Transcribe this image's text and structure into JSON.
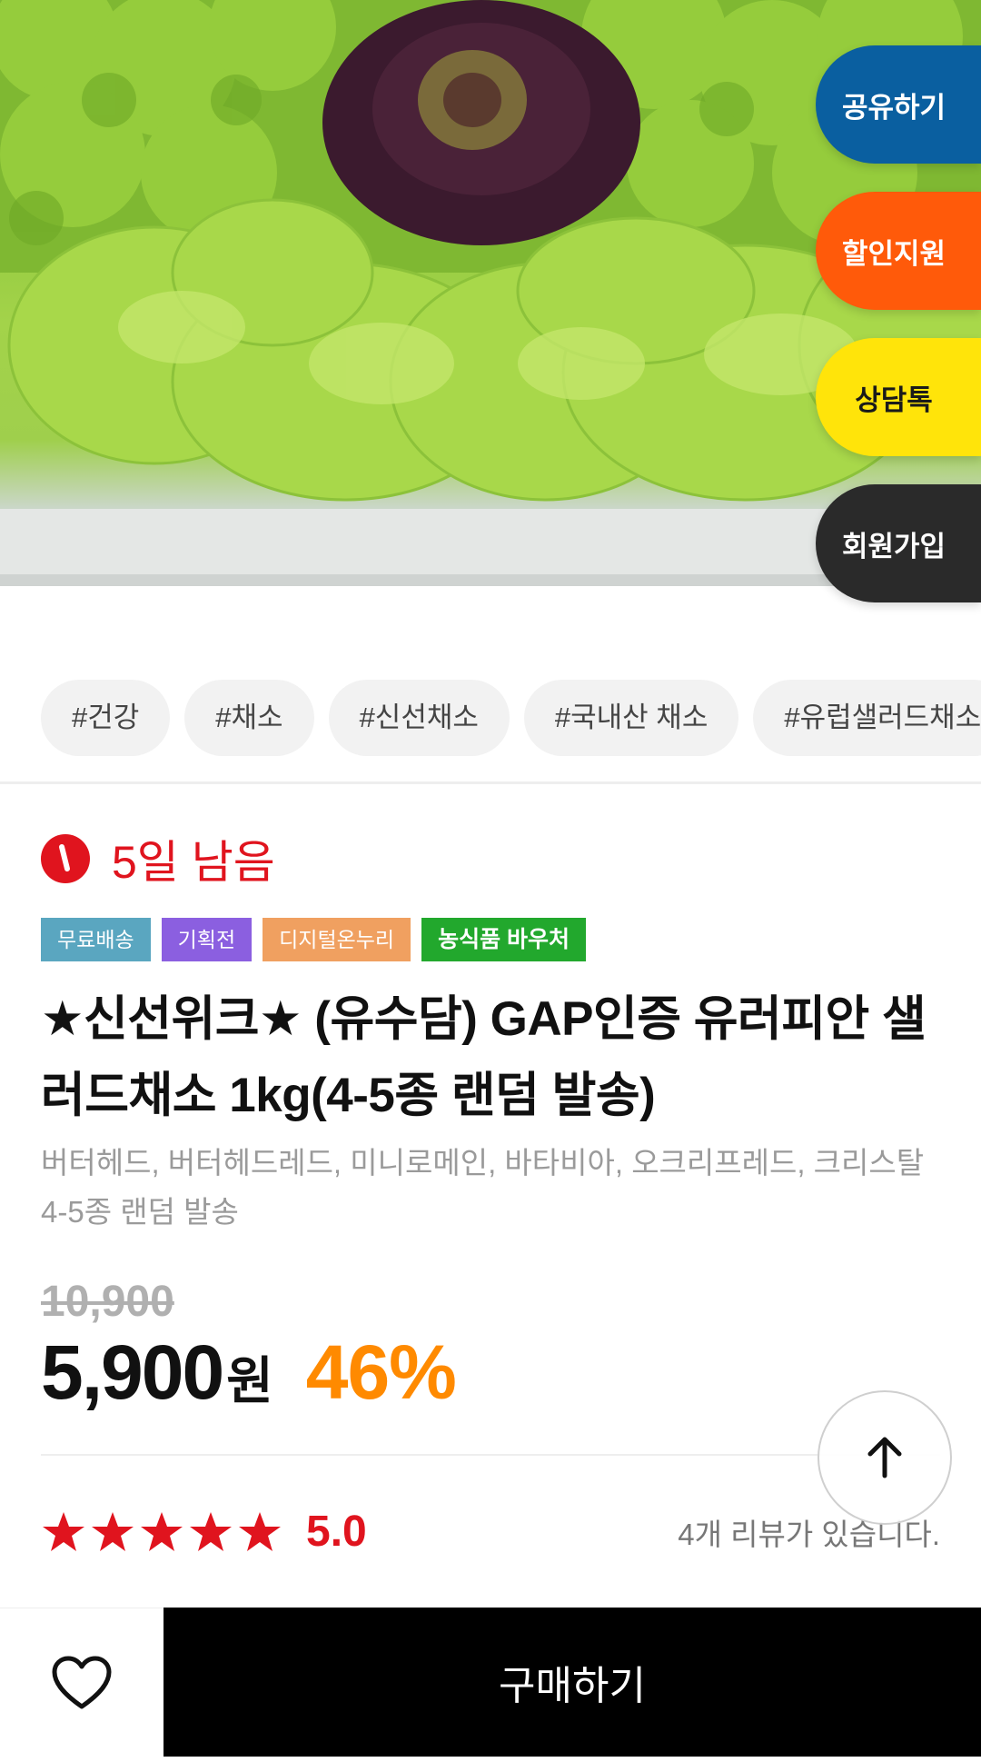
{
  "floating_buttons": {
    "share": "공유하기",
    "discount": "할인지원",
    "chat": "상담톡",
    "join": "회원가입"
  },
  "tags": [
    "#건강",
    "#채소",
    "#신선채소",
    "#국내산 채소",
    "#유럽샐러드채소"
  ],
  "countdown": {
    "text": "5일 남음",
    "icon": "clock-icon"
  },
  "badges": {
    "free_shipping": "무료배송",
    "exhibition": "기획전",
    "digital_onnuri": "디지털온누리",
    "voucher": "농식품 바우처"
  },
  "product": {
    "title": "★신선위크★ (유수담) GAP인증 유러피안 샐러드채소 1kg(4-5종 랜덤 발송)",
    "subtitle": "버터헤드, 버터헤드레드, 미니로메인, 바타비아, 오크리프레드, 크리스탈 4-5종 랜덤 발송",
    "original_price": "10,900",
    "price": "5,900",
    "currency": "원",
    "discount_rate": "46%"
  },
  "rating": {
    "stars": 5,
    "value": "5.0",
    "review_text": "4개 리뷰가 있습니다."
  },
  "bottom_bar": {
    "wishlist_icon": "heart-icon",
    "buy_label": "구매하기"
  },
  "colors": {
    "accent_red": "#e0141e",
    "discount_orange": "#ff8a00",
    "share_blue": "#0a5fa0",
    "discount_btn_orange": "#ff5a0a",
    "chat_yellow": "#ffe40a",
    "join_dark": "#2a2a2a"
  }
}
